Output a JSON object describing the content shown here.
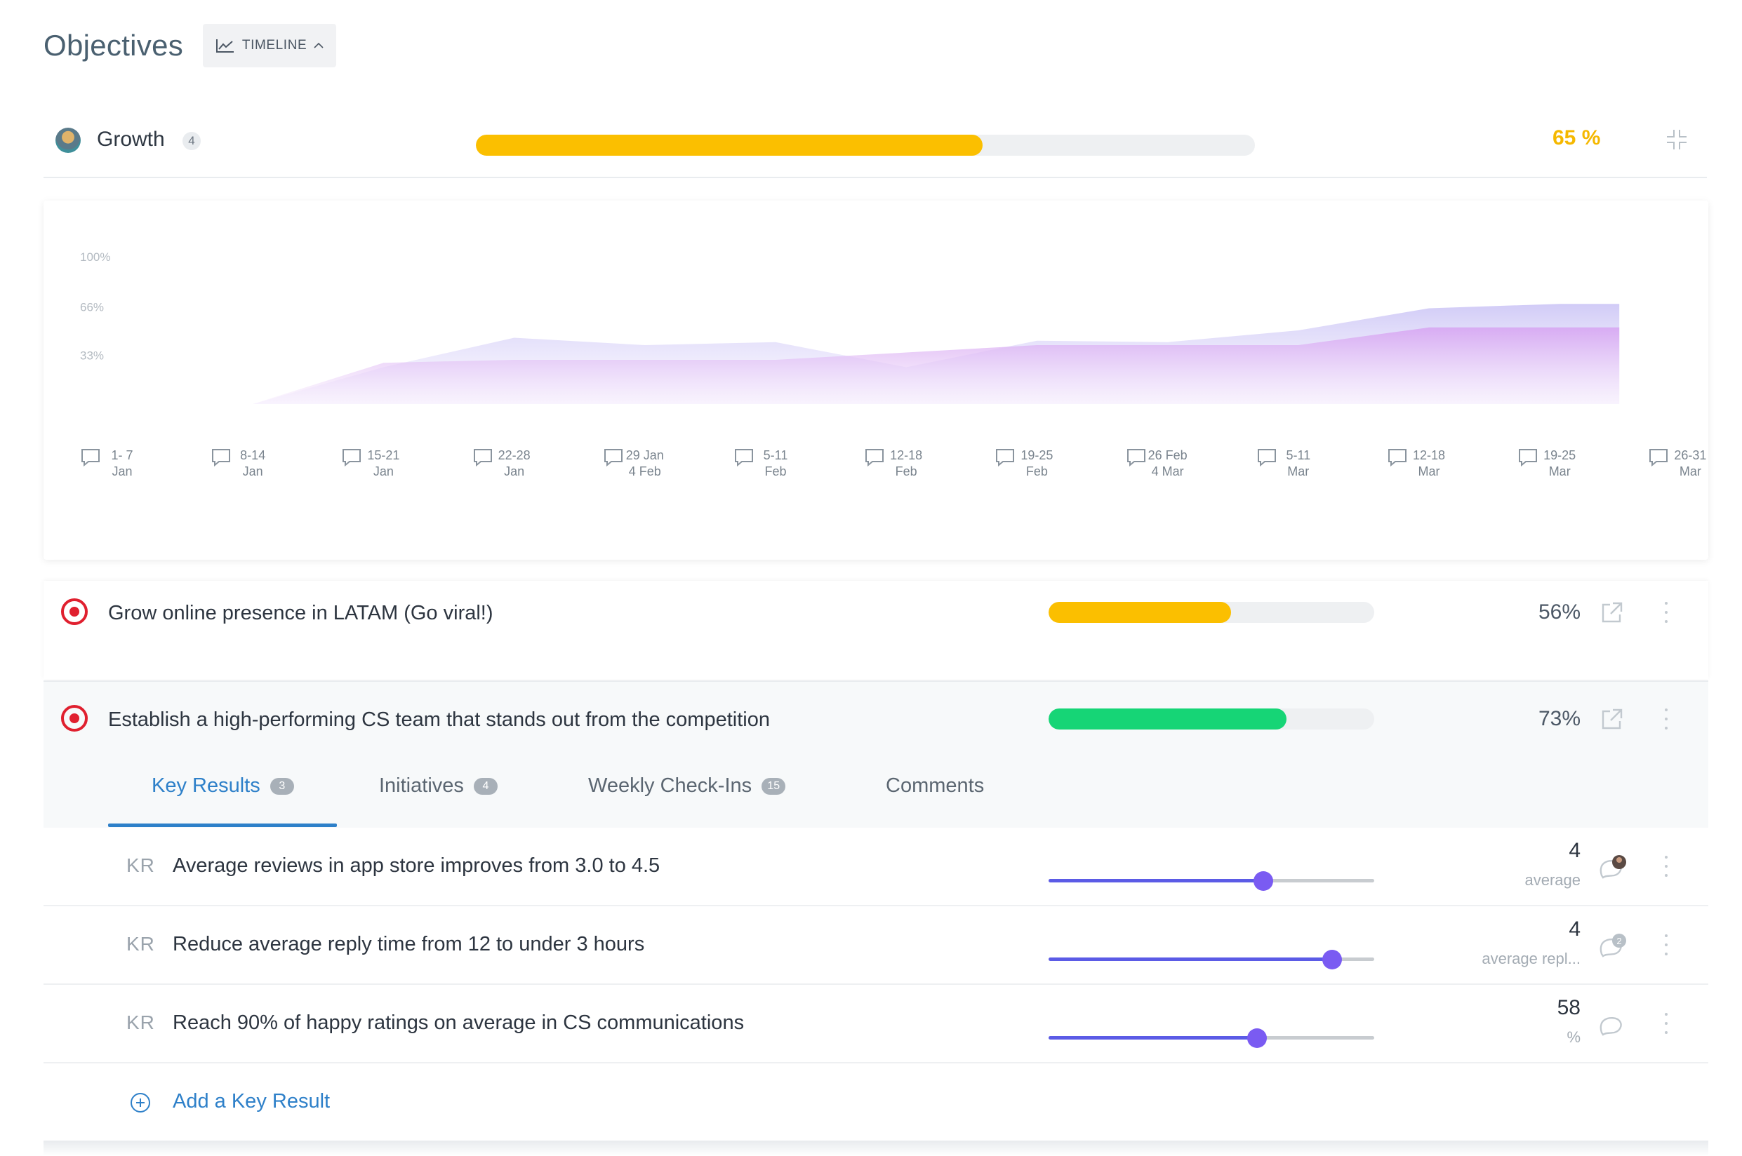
{
  "header": {
    "title": "Objectives",
    "timeline_button": "TIMELINE"
  },
  "growth": {
    "name": "Growth",
    "count": "4",
    "progress": 0.65,
    "percent_label": "65 %",
    "bar_color": "#fbbf00"
  },
  "chart_data": {
    "type": "area",
    "y_tick_labels": [
      "100%",
      "66%",
      "33%"
    ],
    "ylim": [
      0,
      100
    ],
    "categories": [
      "1- 7 Jan",
      "8-14 Jan",
      "15-21 Jan",
      "22-28 Jan",
      "29 Jan 4 Feb",
      "5-11 Feb",
      "12-18 Feb",
      "19-25 Feb",
      "26 Feb 4 Mar",
      "5-11 Mar",
      "12-18 Mar",
      "19-25 Mar",
      "26-31 Mar"
    ],
    "series": [
      {
        "values": [
          null,
          0,
          25,
          45,
          40,
          42,
          25,
          43,
          42,
          50,
          65,
          68,
          null
        ],
        "color": "#c9c2f5"
      },
      {
        "values": [
          null,
          0,
          28,
          30,
          30,
          30,
          35,
          40,
          40,
          40,
          52,
          52,
          null
        ],
        "color": "#d7a6f2"
      }
    ],
    "week_labels": [
      [
        "1- 7",
        "Jan"
      ],
      [
        "8-14",
        "Jan"
      ],
      [
        "15-21",
        "Jan"
      ],
      [
        "22-28",
        "Jan"
      ],
      [
        "29 Jan",
        "4 Feb"
      ],
      [
        "5-11",
        "Feb"
      ],
      [
        "12-18",
        "Feb"
      ],
      [
        "19-25",
        "Feb"
      ],
      [
        "26 Feb",
        "4 Mar"
      ],
      [
        "5-11",
        "Mar"
      ],
      [
        "12-18",
        "Mar"
      ],
      [
        "19-25",
        "Mar"
      ],
      [
        "26-31",
        "Mar"
      ]
    ]
  },
  "objectives": [
    {
      "title": "Grow online presence in LATAM (Go viral!)",
      "progress": 0.56,
      "percent_label": "56%",
      "bar_color": "#fbbf00"
    },
    {
      "title": "Establish a high-performing CS team that stands out from the competition",
      "progress": 0.73,
      "percent_label": "73%",
      "bar_color": "#16d576"
    }
  ],
  "tabs": [
    {
      "label": "Key Results",
      "count": "3",
      "active": true
    },
    {
      "label": "Initiatives",
      "count": "4",
      "active": false
    },
    {
      "label": "Weekly Check-Ins",
      "count": "15",
      "active": false
    },
    {
      "label": "Comments",
      "count": "",
      "active": false
    }
  ],
  "key_results": [
    {
      "tag": "KR",
      "title": "Average reviews in app store improves from 3.0 to 4.5",
      "value": "4",
      "unit": "average",
      "slider": 0.66,
      "comment_badge": "avatar"
    },
    {
      "tag": "KR",
      "title": "Reduce average reply time from 12 to under 3 hours",
      "value": "4",
      "unit": "average repl...",
      "slider": 0.87,
      "comment_badge": "2"
    },
    {
      "tag": "KR",
      "title": "Reach 90% of happy ratings on average in CS communications",
      "value": "58",
      "unit": "%",
      "slider": 0.64,
      "comment_badge": ""
    }
  ],
  "add_key_result": "Add a Key Result"
}
